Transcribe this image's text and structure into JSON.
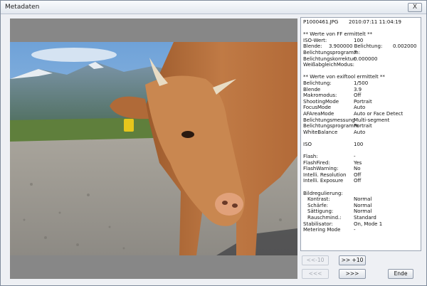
{
  "window": {
    "title": "Metadaten",
    "close_label": "X"
  },
  "metadata_lines": [
    [
      "P1000461.JPG",
      "2010:07:11 11:04:19"
    ],
    [
      ""
    ],
    [
      "** Werte von FF ermittelt **"
    ],
    [
      "ISO-Wert:",
      "100"
    ],
    [
      "Blende:",
      "3.900000 Belichtung:",
      "0.002000"
    ],
    [
      "Belichtungsprogramm:",
      "7"
    ],
    [
      "Belichtungskorrektur:",
      "0.000000"
    ],
    [
      "WeißabgleichModus:"
    ],
    [
      ""
    ],
    [
      "** Werte von exiftool ermittelt **"
    ],
    [
      "Belichtung:",
      "1/500"
    ],
    [
      "Blende",
      "3.9"
    ],
    [
      "Makromodus:",
      "Off"
    ],
    [
      "ShootingMode",
      "Portrait"
    ],
    [
      "FocusMode",
      "Auto"
    ],
    [
      "AFAreaMode",
      "Auto or Face Detect"
    ],
    [
      "Belichtungsmessung",
      "Multi-segment"
    ],
    [
      "Belichtungsprogramm",
      "Portrait"
    ],
    [
      "WhiteBalance",
      "Auto"
    ],
    [
      ""
    ],
    [
      "ISO",
      "100"
    ],
    [
      ""
    ],
    [
      "Flash:",
      "-"
    ],
    [
      "FlashFired:",
      "Yes"
    ],
    [
      "FlashWarning:",
      "No"
    ],
    [
      "Intelli. Resolution",
      "Off"
    ],
    [
      "Intelli. Exposure",
      "Off"
    ],
    [
      ""
    ],
    [
      "Bildregulierung:"
    ],
    [
      "Kontrast:",
      "Normal"
    ],
    [
      "Schärfe:",
      "Normal"
    ],
    [
      "Sättigung:",
      "Normal"
    ],
    [
      "Rauschmind.:",
      "Standard"
    ],
    [
      "Stabilisator:",
      "On, Mode 1"
    ],
    [
      "Metering Mode",
      "-"
    ]
  ],
  "buttons": {
    "prev10": "<<-10",
    "next10": ">> +10",
    "prev": "<<<",
    "next": ">>>",
    "end": "Ende"
  }
}
